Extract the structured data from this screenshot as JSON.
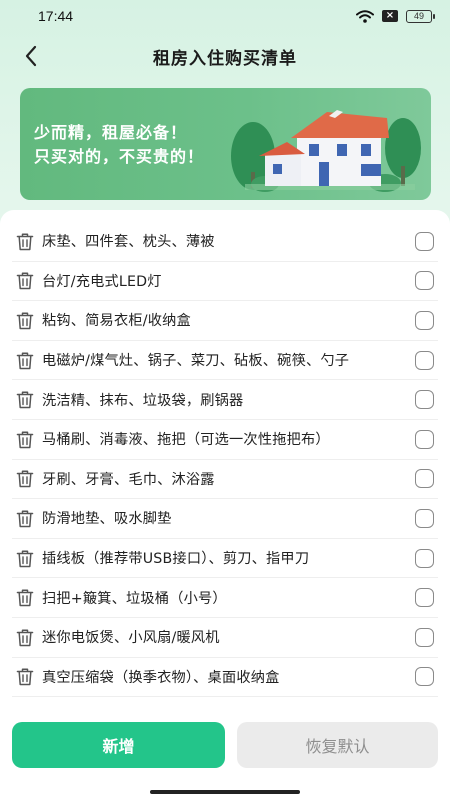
{
  "status_bar": {
    "time": "17:44",
    "battery": "49",
    "icons": [
      "wifi-icon",
      "x-notification-icon",
      "battery-icon"
    ]
  },
  "header": {
    "title": "租房入住购买清单",
    "back_icon": "chevron-left-icon"
  },
  "banner": {
    "line1": "少而精，租屋必备！",
    "line2": "只买对的，不买贵的！",
    "illustration": "house-with-trees"
  },
  "checklist": {
    "items": [
      {
        "label": "床垫、四件套、枕头、薄被",
        "checked": false
      },
      {
        "label": "台灯/充电式LED灯",
        "checked": false
      },
      {
        "label": "粘钩、简易衣柜/收纳盒",
        "checked": false
      },
      {
        "label": "电磁炉/煤气灶、锅子、菜刀、砧板、碗筷、勺子",
        "checked": false
      },
      {
        "label": "洗洁精、抹布、垃圾袋，刷锅器",
        "checked": false
      },
      {
        "label": "马桶刷、消毒液、拖把（可选一次性拖把布）",
        "checked": false
      },
      {
        "label": "牙刷、牙膏、毛巾、沐浴露",
        "checked": false
      },
      {
        "label": "防滑地垫、吸水脚垫",
        "checked": false
      },
      {
        "label": "插线板（推荐带USB接口）、剪刀、指甲刀",
        "checked": false
      },
      {
        "label": "扫把+簸箕、垃圾桶（小号）",
        "checked": false
      },
      {
        "label": "迷你电饭煲、小风扇/暖风机",
        "checked": false
      },
      {
        "label": "真空压缩袋（换季衣物）、桌面收纳盒",
        "checked": false
      }
    ]
  },
  "actions": {
    "add_label": "新增",
    "reset_label": "恢复默认"
  },
  "colors": {
    "accent": "#23c58a",
    "banner": "#6cc08a",
    "reset_bg": "#ebebeb"
  }
}
